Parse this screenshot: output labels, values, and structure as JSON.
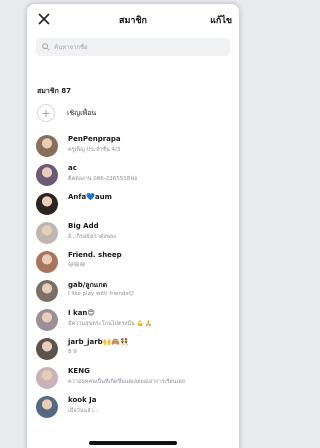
{
  "header": {
    "title": "สมาชิก",
    "edit_label": "แก้ไข"
  },
  "search": {
    "placeholder": "ค้นหาจากชื่อ"
  },
  "members_count_label": "สมาชิก 87",
  "invite_label": "เชิญเพื่อน",
  "members": [
    {
      "name": "PenPenprapa",
      "status": "ครูเพ็ญ ประจำชั้น 4/3",
      "avatar_color": "#8a6d5a"
    },
    {
      "name": "ac",
      "status": "ติดต่องาน 086-2265518ฟอ",
      "avatar_color": "#6b5a78"
    },
    {
      "name": "Anfa💙aum",
      "status": "",
      "avatar_color": "#2b2420"
    },
    {
      "name": "Big Add",
      "status": "อ้...ก็รอยังเราดังพลง",
      "avatar_color": "#bdb7b1"
    },
    {
      "name": "Friend. sheep",
      "status": "😄😄😄",
      "avatar_color": "#a8745c"
    },
    {
      "name": "gab/ลูกแกด",
      "status": "I like play with friends😊",
      "avatar_color": "#7a7068"
    },
    {
      "name": "I kan😊",
      "status": "มีความสุขตระโกนไปตรงนั้น 💪 🙏",
      "avatar_color": "#9a8f95"
    },
    {
      "name": "jarb_jarb🙌🙈👯",
      "status": "8 9",
      "avatar_color": "#5c5250"
    },
    {
      "name": "KENG",
      "status": "ความยุคคนเป็นที่เกิดขึ้นแต่เลยยอเอาการเรียนเลย",
      "avatar_color": "#c7b3b8"
    },
    {
      "name": "kook Ja",
      "status": "เมื่อวันแล้ว...",
      "avatar_color": "#556a82"
    }
  ],
  "colors": {
    "background": "#e9ebef",
    "search_bg": "#f1f2f4",
    "secondary_text": "#8a8f96"
  }
}
